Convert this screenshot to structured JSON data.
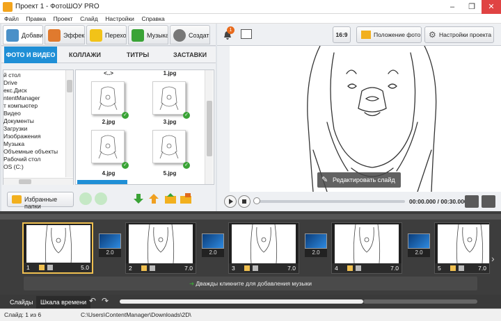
{
  "window": {
    "title": "Проект 1 - ФотоШОУ PRO",
    "minimize": "–",
    "restore": "❐",
    "close": "✕"
  },
  "menu": [
    "Файл",
    "Правка",
    "Проект",
    "Слайд",
    "Настройки",
    "Справка"
  ],
  "main_tabs": [
    {
      "label": "Добавить",
      "icon": "camera-icon",
      "color": "#4a90c8"
    },
    {
      "label": "Эффекты",
      "icon": "palette-icon",
      "color": "#e07a2e"
    },
    {
      "label": "Переходы",
      "icon": "star-icon",
      "color": "#f2c318"
    },
    {
      "label": "Музыка",
      "icon": "music-icon",
      "color": "#3aa336"
    },
    {
      "label": "Создать",
      "icon": "disc-icon",
      "color": "#777777"
    }
  ],
  "sub_tabs": [
    "ФОТО И ВИДЕО",
    "КОЛЛАЖИ",
    "ТИТРЫ",
    "ЗАСТАВКИ"
  ],
  "folders": [
    "й стол",
    "Drive",
    "екс.Диск",
    "ntentManager",
    "т компьютер",
    "Видео",
    "Документы",
    "Загрузки",
    "Изображения",
    "Музыка",
    "Объемные объекты",
    "Рабочий стол",
    "OS (C:)"
  ],
  "files": {
    "up_label": "<..>",
    "names": [
      "1.jpg",
      "2.jpg",
      "3.jpg",
      "4.jpg",
      "5.jpg"
    ]
  },
  "favorites_label": "Избранные папки",
  "toolbar": {
    "notification_count": "1",
    "aspect_ratio": "16:9",
    "photo_position": "Положение фото",
    "project_settings": "Настройки проекта"
  },
  "preview": {
    "edit_slide": "Редактировать слайд"
  },
  "player": {
    "time": "00:00.000 / 00:30.000"
  },
  "slides": [
    {
      "number": "1",
      "duration": "5.0"
    },
    {
      "number": "2",
      "duration": "7.0"
    },
    {
      "number": "3",
      "duration": "7.0"
    },
    {
      "number": "4",
      "duration": "7.0"
    },
    {
      "number": "5",
      "duration": "7.0"
    }
  ],
  "transitions": [
    "2.0",
    "2.0",
    "2.0",
    "2.0"
  ],
  "music_hint": "Дважды кликните для добавления музыки",
  "bottom_tabs": [
    "Слайды",
    "Шкала времени"
  ],
  "status": {
    "slide_count": "Слайд: 1 из 6",
    "path": "C:\\Users\\ContentManager\\Downloads\\2D\\"
  },
  "colors": {
    "accent": "#1f8fd6",
    "selected_slide": "#f0c050",
    "check": "#3aa336"
  }
}
